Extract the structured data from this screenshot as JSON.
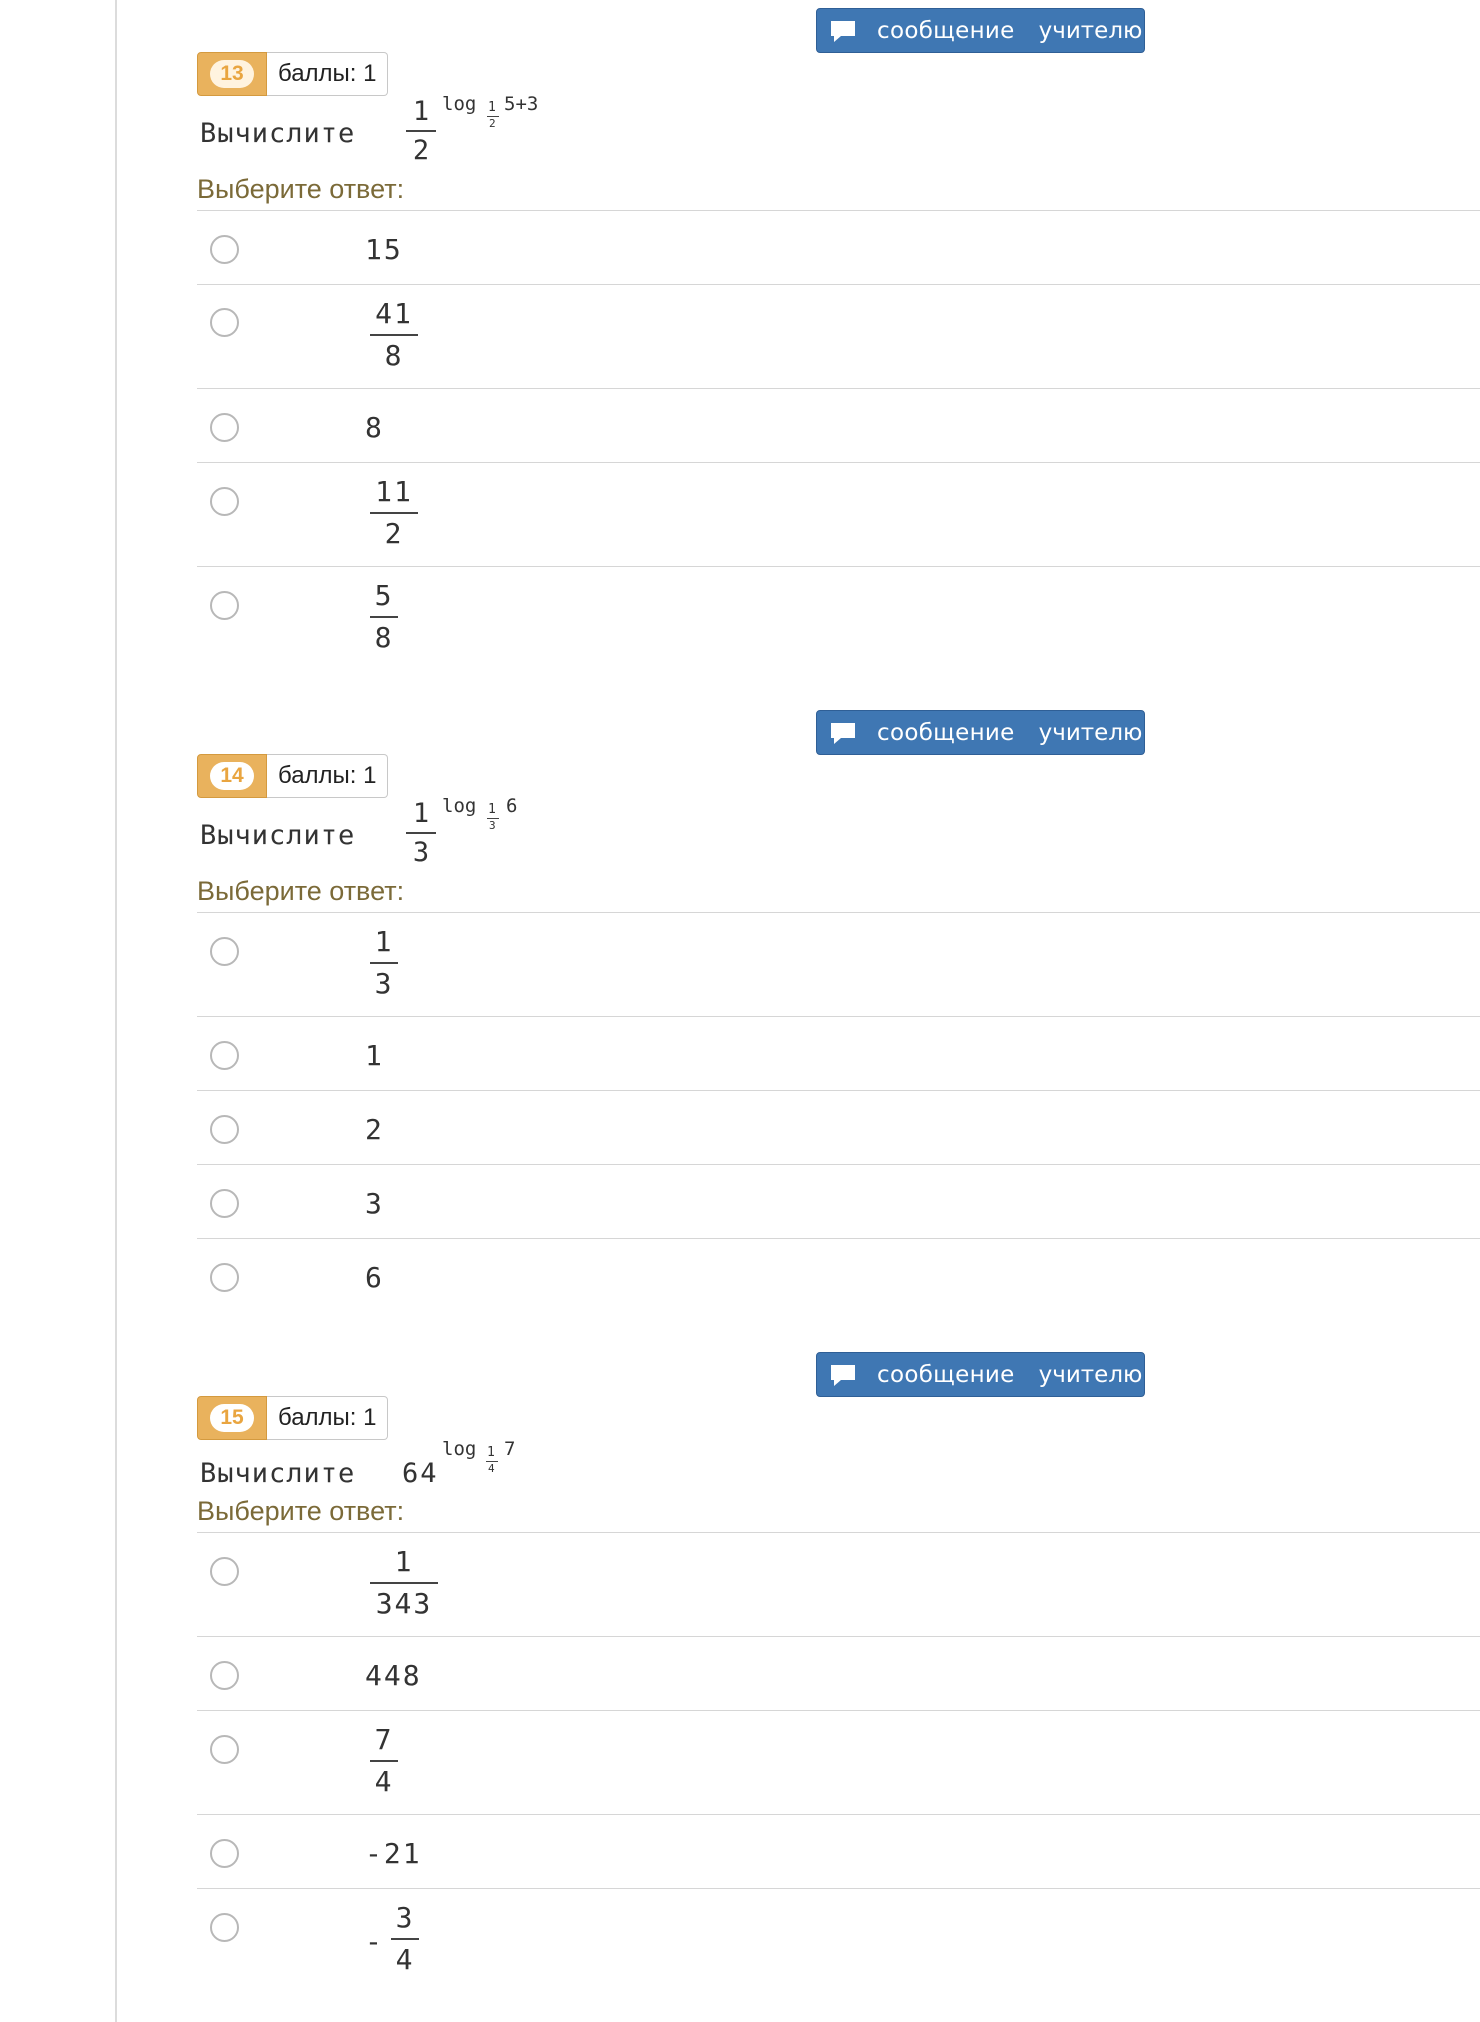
{
  "colors": {
    "accent_button": "#3f77b3",
    "badge": "#e9b25d",
    "prompt_text": "#7b6a38"
  },
  "message_button": {
    "icon": "speech-bubble-icon",
    "word1": "сообщение",
    "word2": "учителю"
  },
  "points_label": "баллы: 1",
  "prompt": "Выберите ответ:",
  "questions": [
    {
      "number": "13",
      "text": "Вычислите",
      "base_num": "1",
      "base_den": "2",
      "log_word": "log",
      "log_base_num": "1",
      "log_base_den": "2",
      "log_arg": "5+3",
      "answers": [
        {
          "plain": "15"
        },
        {
          "num": "41",
          "den": "8"
        },
        {
          "plain": "8"
        },
        {
          "num": "11",
          "den": "2"
        },
        {
          "num": "5",
          "den": "8"
        }
      ]
    },
    {
      "number": "14",
      "text": "Вычислите",
      "base_num": "1",
      "base_den": "3",
      "log_word": "log",
      "log_base_num": "1",
      "log_base_den": "3",
      "log_arg": "6",
      "answers": [
        {
          "num": "1",
          "den": "3"
        },
        {
          "plain": "1"
        },
        {
          "plain": "2"
        },
        {
          "plain": "3"
        },
        {
          "plain": "6"
        }
      ]
    },
    {
      "number": "15",
      "text": "Вычислите",
      "base": "64",
      "log_word": "log",
      "log_base_num": "1",
      "log_base_den": "4",
      "log_arg": "7",
      "answers": [
        {
          "num": "1",
          "den": "343"
        },
        {
          "plain": "448"
        },
        {
          "num": "7",
          "den": "4"
        },
        {
          "plain": "-21"
        },
        {
          "sign": "-",
          "num": "3",
          "den": "4"
        }
      ]
    }
  ]
}
